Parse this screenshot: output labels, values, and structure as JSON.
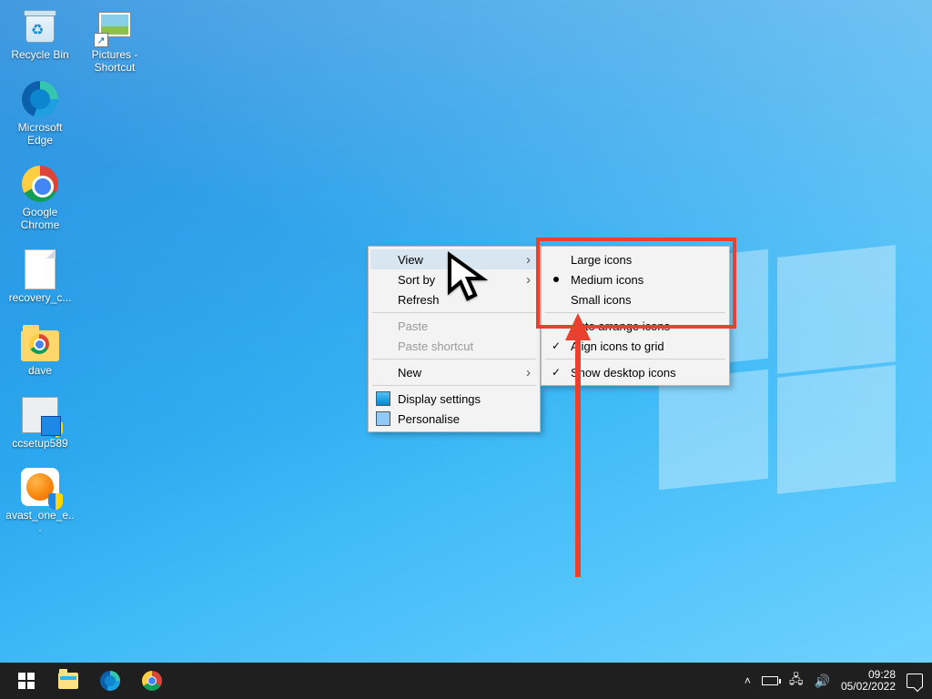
{
  "desktop": {
    "icons_col1": [
      {
        "name": "recycle-bin",
        "label": "Recycle Bin"
      },
      {
        "name": "microsoft-edge",
        "label": "Microsoft Edge"
      },
      {
        "name": "google-chrome",
        "label": "Google Chrome"
      },
      {
        "name": "recovery-file",
        "label": "recovery_c..."
      },
      {
        "name": "dave-folder",
        "label": "dave"
      },
      {
        "name": "ccsetup589",
        "label": "ccsetup589"
      },
      {
        "name": "avast-one",
        "label": "avast_one_e..."
      }
    ],
    "icons_col2": [
      {
        "name": "pictures-shortcut",
        "label": "Pictures - Shortcut"
      }
    ]
  },
  "context_menu": {
    "view": "View",
    "sort_by": "Sort by",
    "refresh": "Refresh",
    "paste": "Paste",
    "paste_shortcut": "Paste shortcut",
    "new": "New",
    "display_settings": "Display settings",
    "personalise": "Personalise"
  },
  "view_submenu": {
    "large": "Large icons",
    "medium": "Medium icons",
    "small": "Small icons",
    "auto_arrange": "Auto arrange icons",
    "align_grid": "Align icons to grid",
    "show_desktop": "Show desktop icons"
  },
  "taskbar": {
    "time": "09:28",
    "date": "05/02/2022"
  }
}
